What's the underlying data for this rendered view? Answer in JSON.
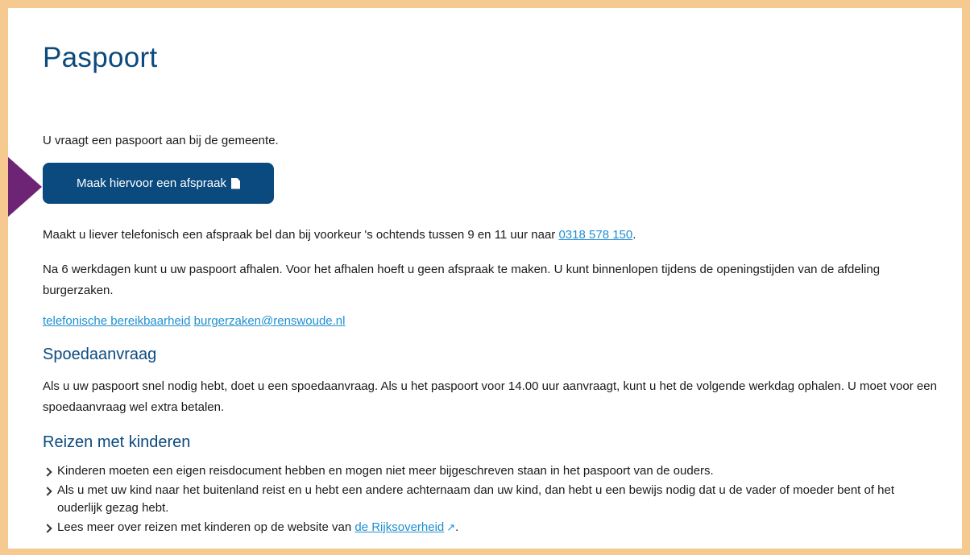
{
  "page": {
    "title": "Paspoort",
    "intro": "U vraagt een paspoort aan bij de gemeente.",
    "appointment_button": "Maak hiervoor een afspraak",
    "phone_text": "Maakt u liever telefonisch een afspraak bel dan bij voorkeur 's ochtends tussen 9 en 11 uur naar ",
    "phone_link": "0318 578 150",
    "phone_after": ".",
    "pickup_text": "Na 6 werkdagen kunt u uw paspoort afhalen. Voor het afhalen hoeft u geen afspraak te maken. U kunt binnenlopen tijdens de openingstijden van de afdeling burgerzaken.",
    "link_reachability": "telefonische bereikbaarheid",
    "link_email": "burgerzaken@renswoude.nl"
  },
  "urgent": {
    "heading": "Spoedaanvraag",
    "text": "Als u uw paspoort snel nodig hebt, doet u een spoedaanvraag. Als u het paspoort voor 14.00 uur aanvraagt, kunt u het de volgende werkdag ophalen. U moet voor een spoedaanvraag wel extra betalen."
  },
  "children": {
    "heading": "Reizen met kinderen",
    "item1": "Kinderen moeten een eigen reisdocument hebben en mogen niet meer bijgeschreven staan in het paspoort van de ouders.",
    "item2": "Als u met uw kind naar het buitenland reist en u hebt een andere achternaam dan uw kind, dan hebt u een bewijs nodig dat u de vader of moeder bent of het ouderlijk gezag hebt.",
    "item3_before": "Lees meer over reizen met kinderen op de website van ",
    "item3_link": "de Rijksoverheid",
    "item3_after": "."
  },
  "colors": {
    "frame": "#f5c98f",
    "heading": "#0b4a7e",
    "button": "#0b4a7e",
    "link": "#1f8fd1",
    "arrow": "#6e2474"
  },
  "icons": {
    "button_icon": "document-icon",
    "external_icon": "external-link-icon",
    "bullet_icon": "chevron-right-icon",
    "pointer": "arrow-pointer"
  }
}
